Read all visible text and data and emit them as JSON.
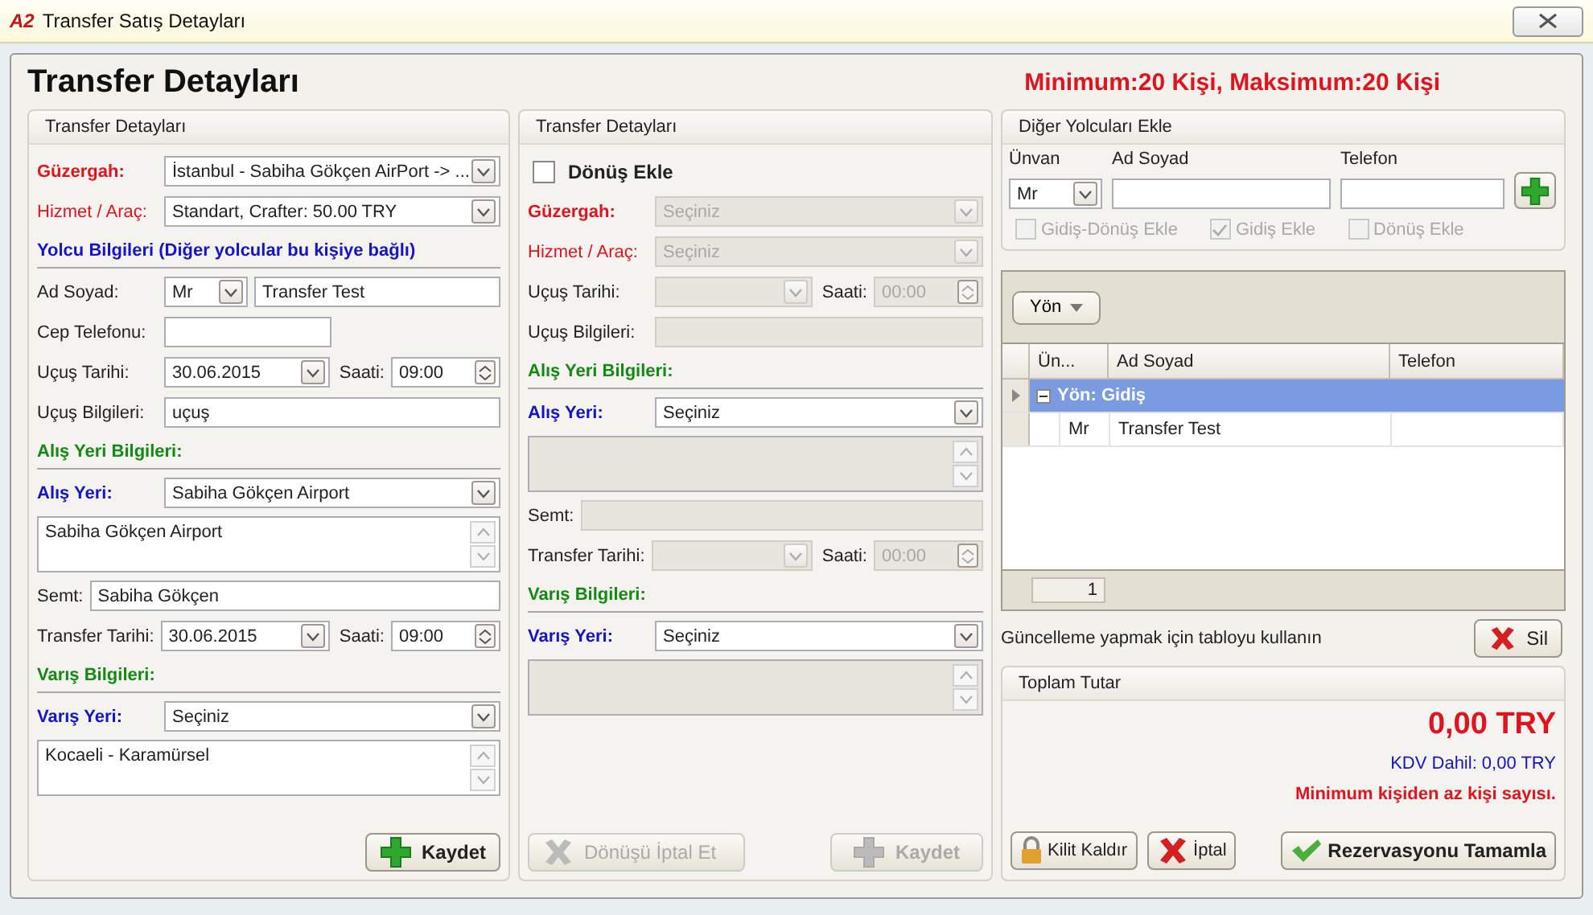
{
  "window": {
    "logo": "A2",
    "title": "Transfer Satış Detayları"
  },
  "heading": "Transfer Detayları",
  "limit_notice": "Minimum:20 Kişi, Maksimum:20 Kişi",
  "outbound": {
    "title": "Transfer Detayları",
    "rows": [
      {
        "kind": "select",
        "label": "Güzergah:",
        "color": "#e0141e",
        "bold": true,
        "value": "İstanbul - Sabiha Gökçen AirPort -> ...",
        "disabled": false
      },
      {
        "kind": "select",
        "label": "Hizmet / Araç:",
        "color": "#e0141e",
        "bold": false,
        "value": "Standart, Crafter: 50.00 TRY",
        "disabled": false
      },
      {
        "kind": "section",
        "label": "Yolcu Bilgileri (Diğer yolcular bu kişiye bağlı)",
        "color": "#1414c8",
        "bold": true
      },
      {
        "kind": "name",
        "label": "Ad Soyad:",
        "color": "#222222",
        "bold": false,
        "title": "Mr",
        "value": "Transfer Test",
        "disabled": false
      },
      {
        "kind": "text",
        "label": "Cep Telefonu:",
        "color": "#222222",
        "bold": false,
        "short": true,
        "disabled": false
      },
      {
        "kind": "datetime",
        "label": "Uçuş Tarihi:",
        "color": "#222222",
        "bold": false,
        "date": "30.06.2015",
        "time_label": "Saati:",
        "time": "09:00",
        "disabled": false
      },
      {
        "kind": "text",
        "label": "Uçuş Bilgileri:",
        "color": "#222222",
        "bold": false,
        "value": "uçuş",
        "disabled": false
      },
      {
        "kind": "section",
        "label": "Alış Yeri Bilgileri:",
        "color": "#138a13",
        "bold": true
      },
      {
        "kind": "select",
        "label": "Alış Yeri:",
        "color": "#1414c8",
        "bold": true,
        "value": "Sabiha Gökçen Airport",
        "disabled": false
      },
      {
        "kind": "memo",
        "value": "Sabiha Gökçen Airport",
        "disabled": false
      },
      {
        "kind": "text",
        "label": "Semt:",
        "color": "#222222",
        "bold": false,
        "value": "Sabiha Gökçen",
        "compact": true,
        "disabled": false
      },
      {
        "kind": "datetime",
        "label": "Transfer Tarihi:",
        "color": "#222222",
        "bold": false,
        "date": "30.06.2015",
        "time_label": "Saati:",
        "time": "09:00",
        "compact": true,
        "disabled": false
      },
      {
        "kind": "section",
        "label": "Varış Bilgileri:",
        "color": "#138a13",
        "bold": true
      },
      {
        "kind": "select",
        "label": "Varış Yeri:",
        "color": "#1414c8",
        "bold": true,
        "value": "Seçiniz",
        "disabled": false
      },
      {
        "kind": "memo",
        "value": "Kocaeli - Karamürsel",
        "disabled": false
      }
    ],
    "buttons": [
      {
        "label": "Kaydet",
        "kind": "save",
        "disabled": false
      }
    ]
  },
  "inbound": {
    "title": "Transfer Detayları",
    "rows": [
      {
        "kind": "checkbox",
        "label": "Dönüş Ekle",
        "checked": false
      },
      {
        "kind": "select",
        "label": "Güzergah:",
        "color": "#e0141e",
        "bold": true,
        "value": "Seçiniz",
        "disabled": true
      },
      {
        "kind": "select",
        "label": "Hizmet / Araç:",
        "color": "#e0141e",
        "bold": false,
        "value": "Seçiniz",
        "disabled": true
      },
      {
        "kind": "datetime",
        "label": "Uçuş Tarihi:",
        "color": "#222222",
        "bold": false,
        "time_label": "Saati:",
        "time": "00:00",
        "disabled": true
      },
      {
        "kind": "text",
        "label": "Uçuş Bilgileri:",
        "color": "#222222",
        "bold": false,
        "disabled": true
      },
      {
        "kind": "section",
        "label": "Alış Yeri Bilgileri:",
        "color": "#138a13",
        "bold": true
      },
      {
        "kind": "select",
        "label": "Alış Yeri:",
        "color": "#1414c8",
        "bold": true,
        "value": "Seçiniz",
        "disabled": false
      },
      {
        "kind": "memo",
        "disabled": true
      },
      {
        "kind": "text",
        "label": "Semt:",
        "color": "#222222",
        "bold": false,
        "compact": true,
        "disabled": true
      },
      {
        "kind": "datetime",
        "label": "Transfer Tarihi:",
        "color": "#222222",
        "bold": false,
        "time_label": "Saati:",
        "time": "00:00",
        "compact": true,
        "disabled": true
      },
      {
        "kind": "section",
        "label": "Varış Bilgileri:",
        "color": "#138a13",
        "bold": true
      },
      {
        "kind": "select",
        "label": "Varış Yeri:",
        "color": "#1414c8",
        "bold": true,
        "value": "Seçiniz",
        "disabled": false
      },
      {
        "kind": "memo",
        "disabled": true
      }
    ],
    "buttons": [
      {
        "label": "Dönüşü İptal Et",
        "kind": "cancel",
        "disabled": true
      },
      {
        "label": "Kaydet",
        "kind": "save",
        "disabled": true
      }
    ]
  },
  "passengers": {
    "title": "Diğer Yolcuları Ekle",
    "title_label": "Ünvan",
    "title_value": "Mr",
    "name_label": "Ad Soyad",
    "phone_label": "Telefon",
    "options": [
      {
        "label": "Gidiş-Dönüş Ekle",
        "checked": false,
        "disabled": true
      },
      {
        "label": "Gidiş Ekle",
        "checked": true,
        "disabled": true
      },
      {
        "label": "Dönüş Ekle",
        "checked": false,
        "disabled": true
      }
    ]
  },
  "grid": {
    "group_button": "Yön",
    "columns": [
      "Ün...",
      "Ad Soyad",
      "Telefon"
    ],
    "groups": [
      {
        "label": "Yön: Gidiş",
        "expanded": true,
        "selected": true,
        "rows": [
          {
            "cells": [
              "Mr",
              "Transfer Test"
            ]
          }
        ]
      }
    ],
    "footer_count": "1"
  },
  "grid_hint": "Güncelleme yapmak için tabloyu kullanın",
  "delete_button": "Sil",
  "total": {
    "title": "Toplam Tutar",
    "amount": "0,00 TRY",
    "tax": "KDV Dahil: 0,00 TRY",
    "warning": "Minimum kişiden az kişi sayısı."
  },
  "actions": [
    {
      "label": "Kilit Kaldır",
      "kind": "unlock"
    },
    {
      "label": "İptal",
      "kind": "cancel"
    },
    {
      "label": "Rezervasyonu Tamamla",
      "kind": "confirm"
    }
  ]
}
